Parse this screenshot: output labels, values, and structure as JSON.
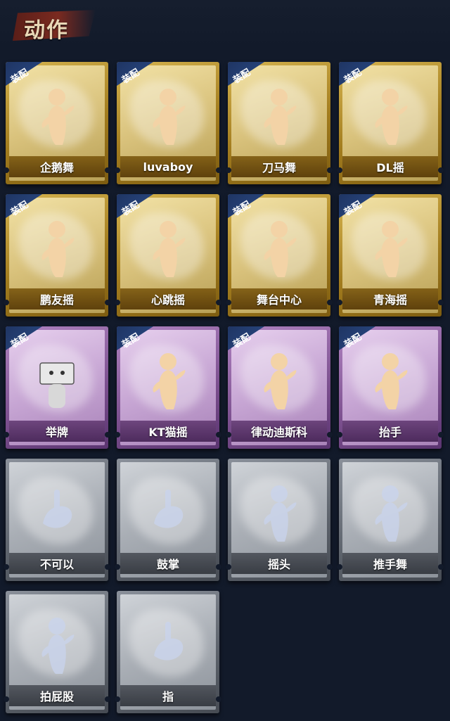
{
  "header": {
    "title": "动作"
  },
  "equip_label": "装配",
  "colors": {
    "gold": "#c9a43a",
    "purple": "#9a6bb0",
    "gray": "#7a8088",
    "equip_tag": "#24407a",
    "background": "#121a2a"
  },
  "actions": [
    {
      "name": "企鹅舞",
      "rarity": "gold",
      "equipped": true,
      "icon": "dance-figure-icon"
    },
    {
      "name": "luvaboy",
      "rarity": "gold",
      "equipped": true,
      "icon": "dance-figure-icon"
    },
    {
      "name": "刀马舞",
      "rarity": "gold",
      "equipped": true,
      "icon": "dance-figure-icon"
    },
    {
      "name": "DL摇",
      "rarity": "gold",
      "equipped": true,
      "icon": "dance-figure-icon"
    },
    {
      "name": "鹏友摇",
      "rarity": "gold",
      "equipped": true,
      "icon": "dance-figure-icon"
    },
    {
      "name": "心跳摇",
      "rarity": "gold",
      "equipped": true,
      "icon": "dance-figure-icon"
    },
    {
      "name": "舞台中心",
      "rarity": "gold",
      "equipped": true,
      "icon": "dance-figure-icon"
    },
    {
      "name": "青海摇",
      "rarity": "gold",
      "equipped": true,
      "icon": "dance-figure-icon"
    },
    {
      "name": "举牌",
      "rarity": "purple",
      "equipped": true,
      "icon": "sign-figure-icon"
    },
    {
      "name": "KT猫摇",
      "rarity": "purple",
      "equipped": true,
      "icon": "dance-figure-icon"
    },
    {
      "name": "律动迪斯科",
      "rarity": "purple",
      "equipped": true,
      "icon": "disco-figure-icon"
    },
    {
      "name": "抬手",
      "rarity": "purple",
      "equipped": true,
      "icon": "raise-hand-figure-icon"
    },
    {
      "name": "不可以",
      "rarity": "gray",
      "equipped": false,
      "icon": "finger-wag-icon"
    },
    {
      "name": "鼓掌",
      "rarity": "gray",
      "equipped": false,
      "icon": "clapping-hands-icon"
    },
    {
      "name": "摇头",
      "rarity": "gray",
      "equipped": false,
      "icon": "shake-head-figure-icon"
    },
    {
      "name": "推手舞",
      "rarity": "gray",
      "equipped": false,
      "icon": "push-hands-figure-icon"
    },
    {
      "name": "拍屁股",
      "rarity": "gray",
      "equipped": false,
      "icon": "slap-figure-icon"
    },
    {
      "name": "指",
      "rarity": "gray",
      "equipped": false,
      "icon": "pointing-hand-icon"
    }
  ]
}
